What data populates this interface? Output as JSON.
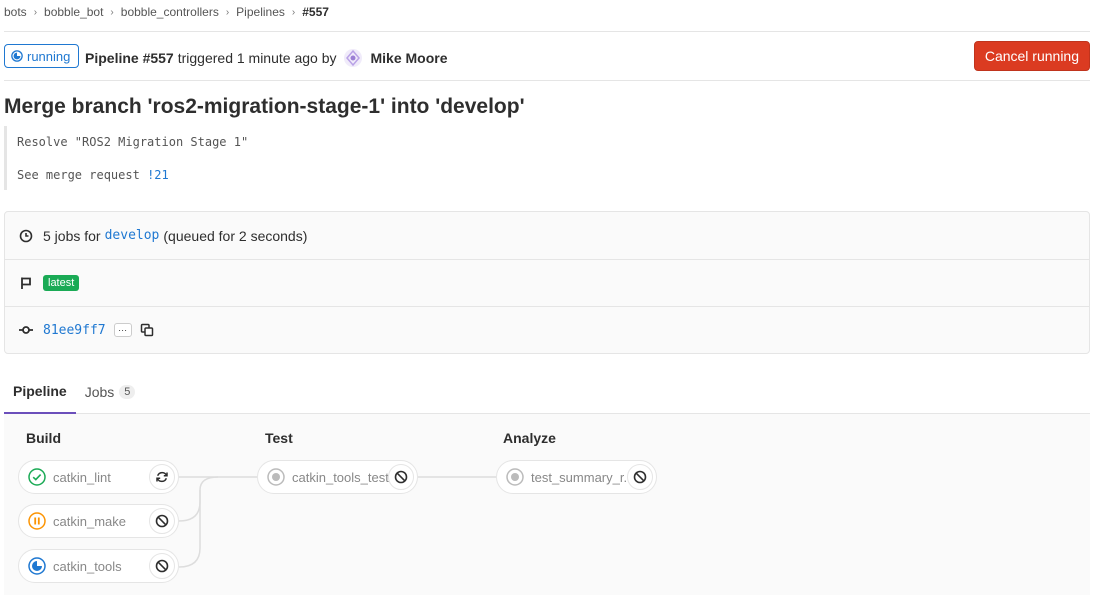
{
  "breadcrumb": {
    "items": [
      "bots",
      "bobble_bot",
      "bobble_controllers",
      "Pipelines",
      "#557"
    ]
  },
  "header": {
    "status": "running",
    "pipeline_label": "Pipeline #557",
    "triggered_text": "triggered 1 minute ago by",
    "user_name": "Mike Moore",
    "cancel_label": "Cancel running"
  },
  "commit": {
    "title": "Merge branch 'ros2-migration-stage-1' into 'develop'",
    "description_line1": "Resolve \"ROS2 Migration Stage 1\"",
    "description_line2_prefix": "See merge request",
    "merge_request_link": "!21"
  },
  "info": {
    "jobs_prefix": "5 jobs for",
    "branch": "develop",
    "queued_text": "(queued for 2 seconds)",
    "badge": "latest",
    "sha": "81ee9ff7",
    "ellipsis": "···"
  },
  "tabs": {
    "pipeline_label": "Pipeline",
    "jobs_label": "Jobs",
    "jobs_count": "5"
  },
  "stages": {
    "build": {
      "title": "Build",
      "jobs": [
        {
          "name": "catkin_lint",
          "status": "passed",
          "action": "retry"
        },
        {
          "name": "catkin_make",
          "status": "manual-paused",
          "action": "cancel"
        },
        {
          "name": "catkin_tools",
          "status": "running",
          "action": "cancel"
        }
      ]
    },
    "test": {
      "title": "Test",
      "jobs": [
        {
          "name": "catkin_tools_tests",
          "status": "created",
          "action": "cancel"
        }
      ]
    },
    "analyze": {
      "title": "Analyze",
      "jobs": [
        {
          "name": "test_summary_r...",
          "status": "created",
          "action": "cancel"
        }
      ]
    }
  },
  "colors": {
    "primary": "#1f78d1",
    "danger": "#db3b21",
    "success": "#1aaa55",
    "warning": "#fc9403",
    "tab_active": "#6b4fbb"
  }
}
